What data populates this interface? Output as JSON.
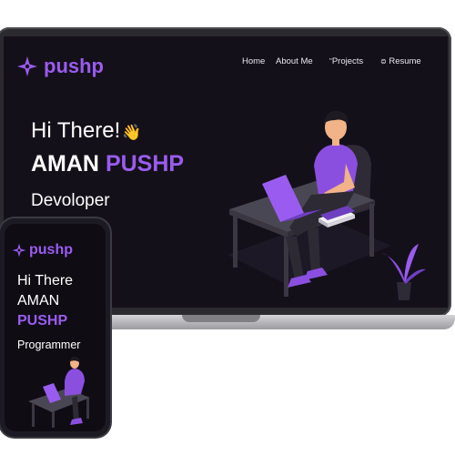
{
  "brand": {
    "name": "pushp",
    "logo_icon": "four-point-star-icon",
    "accent": "#9a5cf0"
  },
  "laptop": {
    "nav": [
      {
        "label": "Home",
        "icon": ""
      },
      {
        "label": "About Me",
        "icon": ""
      },
      {
        "label": "Projects",
        "icon": "quote-mark-icon"
      },
      {
        "label": "Resume",
        "icon": "document-icon"
      }
    ],
    "hero": {
      "greeting": "Hi There!",
      "wave_icon": "waving-hand-icon",
      "name_first": "AMAN",
      "name_last": "PUSHP",
      "role": "Devoloper"
    },
    "screen_bg": "#141019"
  },
  "phone": {
    "greeting": "Hi There",
    "name_first": "AMAN",
    "name_last": "PUSHP",
    "role": "Programmer"
  }
}
